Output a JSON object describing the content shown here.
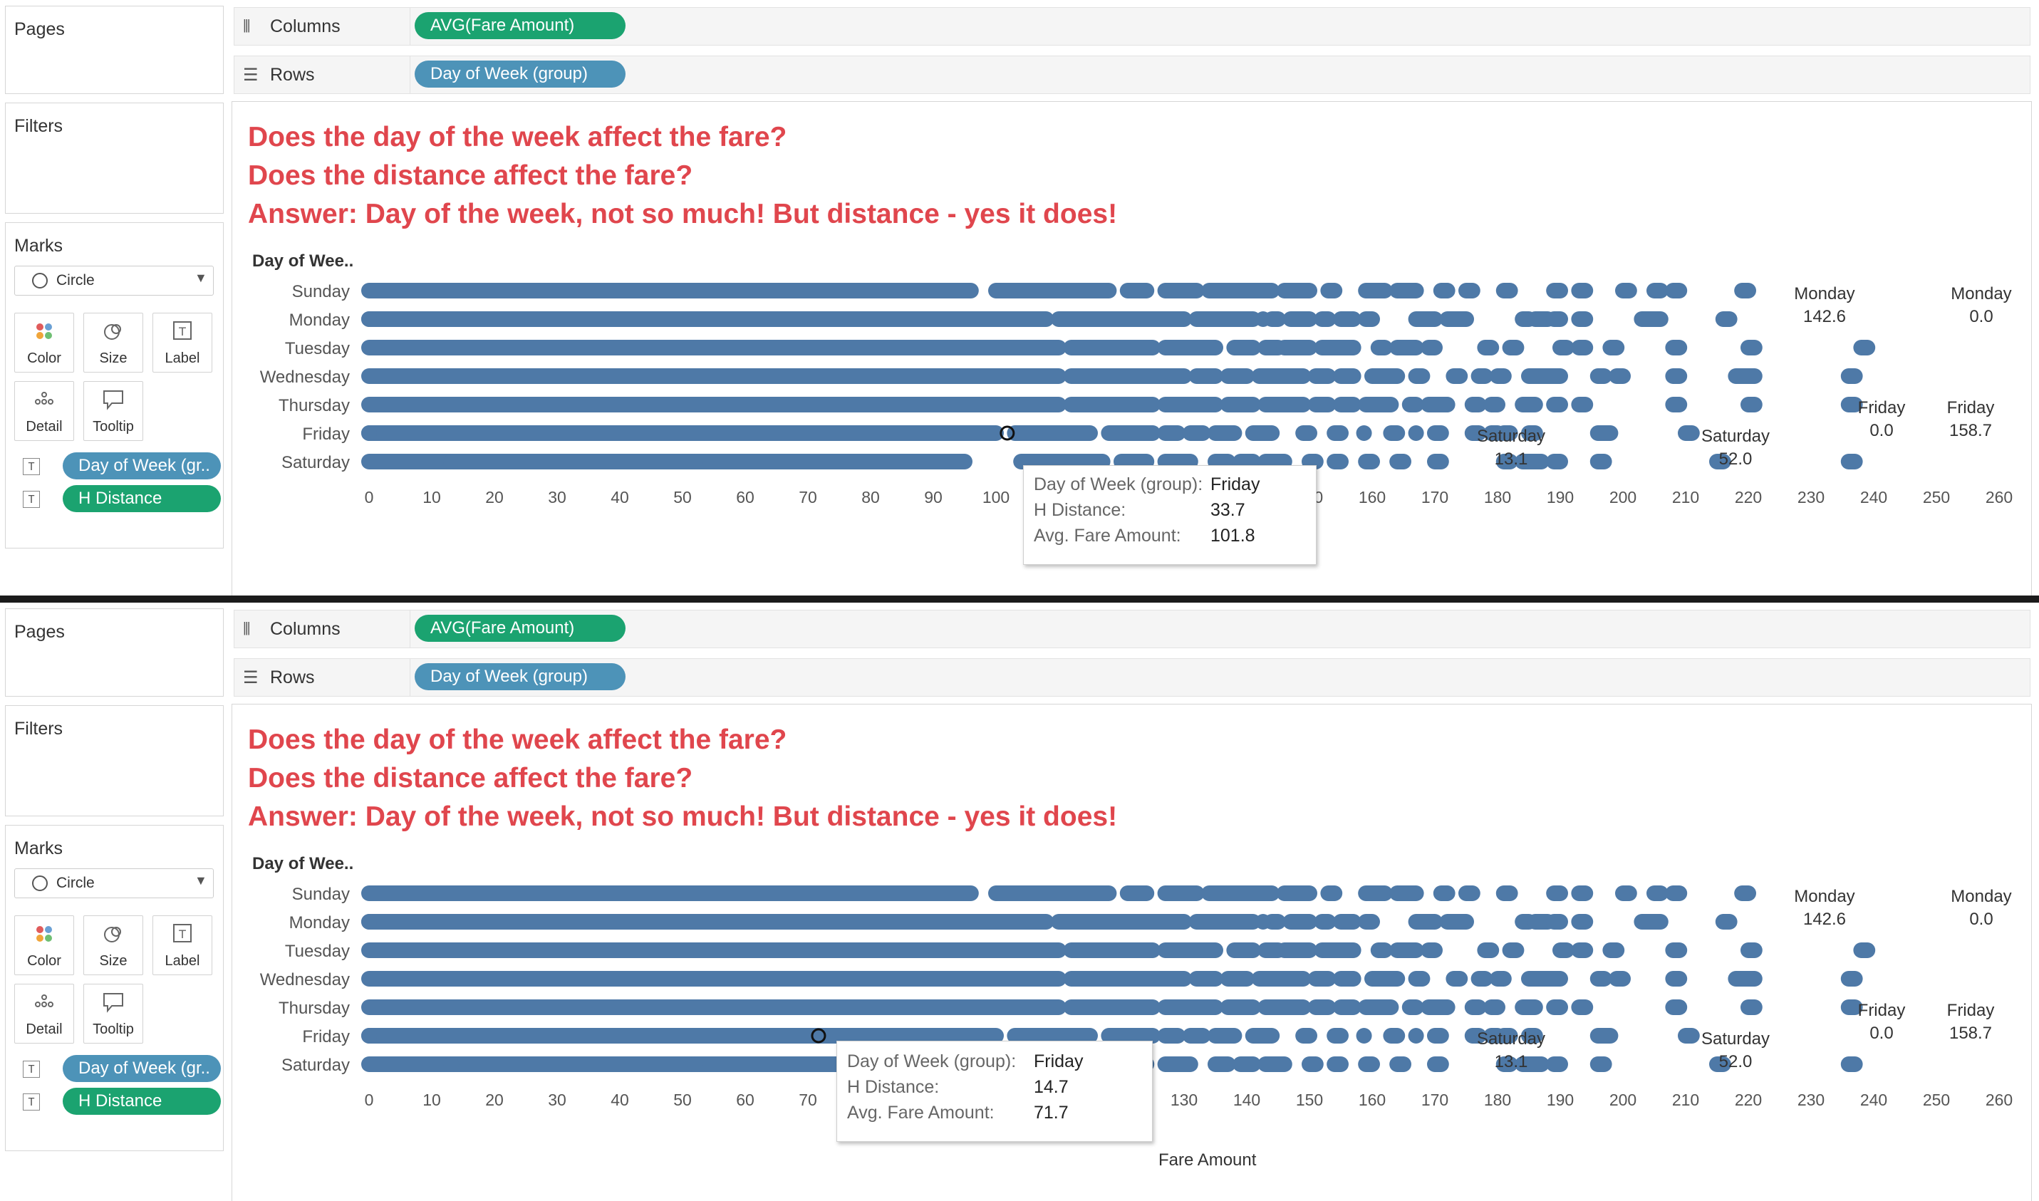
{
  "side": {
    "pages": "Pages",
    "filters": "Filters",
    "marks": "Marks"
  },
  "shelves": {
    "columns_label": "Columns",
    "rows_label": "Rows",
    "columns_pill": "AVG(Fare Amount)",
    "rows_pill": "Day of Week (group)"
  },
  "marks": {
    "type": "Circle",
    "buttons": {
      "color": "Color",
      "size": "Size",
      "label": "Label",
      "detail": "Detail",
      "tooltip": "Tooltip"
    },
    "fields": [
      "Day of Week (gr..",
      "H Distance"
    ]
  },
  "colors": {
    "title_red": "#e0464d",
    "mark_blue": "#4e79a7",
    "pill_green": "#1ba370",
    "pill_blue": "#4d93b8"
  },
  "icons": {
    "columns": "columns-icon",
    "rows": "rows-icon",
    "circle": "circle-icon",
    "dropdown": "chevron-down-icon",
    "color": "color-dots-icon",
    "size": "size-icon",
    "label": "label-icon",
    "detail": "detail-icon",
    "tooltip": "tooltip-icon",
    "field_type": "text-type-icon"
  },
  "viz": {
    "q1": "Does the day of the week affect the fare?",
    "q2": "Does the distance affect the fare?",
    "q3": "Answer: Day of the week, not so much! But distance - yes it does!",
    "row_header": "Day of Wee.."
  },
  "chart_data": {
    "type": "scatter",
    "y_categories": [
      "Sunday",
      "Monday",
      "Tuesday",
      "Wednesday",
      "Thursday",
      "Friday",
      "Saturday"
    ],
    "x_ticks": [
      0,
      10,
      20,
      30,
      40,
      50,
      60,
      70,
      80,
      90,
      100,
      110,
      120,
      130,
      140,
      150,
      160,
      170,
      180,
      190,
      200,
      210,
      220,
      230,
      240,
      250,
      260
    ],
    "xlim": [
      0,
      260
    ],
    "xlabel": "Fare Amount",
    "series_values": {
      "Sunday": [
        [
          0,
          96
        ],
        [
          100,
          118
        ],
        [
          121,
          124
        ],
        [
          127,
          132
        ],
        [
          134,
          144
        ],
        [
          146,
          150
        ],
        [
          153,
          154
        ],
        [
          159,
          162
        ],
        [
          164,
          167
        ],
        [
          171,
          172
        ],
        [
          175,
          176
        ],
        [
          181,
          182
        ],
        [
          189,
          190
        ],
        [
          193,
          194
        ],
        [
          200,
          201
        ],
        [
          205,
          206
        ],
        [
          208,
          209
        ],
        [
          219,
          220
        ]
      ],
      "Monday": [
        [
          0,
          108
        ],
        [
          110,
          130
        ],
        [
          132,
          141
        ],
        [
          144,
          145
        ],
        [
          147,
          150
        ],
        [
          152,
          153
        ],
        [
          155,
          157
        ],
        [
          159,
          160
        ],
        [
          167,
          170
        ],
        [
          172,
          175
        ],
        [
          184,
          185
        ],
        [
          186,
          188
        ],
        [
          189,
          190
        ],
        [
          193,
          194
        ],
        [
          203,
          206
        ],
        [
          216,
          217
        ]
      ],
      "Tuesday": [
        [
          0,
          110
        ],
        [
          112,
          125
        ],
        [
          127,
          135
        ],
        [
          138,
          141
        ],
        [
          143,
          145
        ],
        [
          146,
          150
        ],
        [
          152,
          157
        ],
        [
          161,
          162
        ],
        [
          164,
          167
        ],
        [
          169,
          170
        ],
        [
          178,
          179
        ],
        [
          182,
          183
        ],
        [
          190,
          191
        ],
        [
          193,
          194
        ],
        [
          198,
          199
        ],
        [
          208,
          209
        ],
        [
          220,
          221
        ],
        [
          238,
          239
        ]
      ],
      "Wednesday": [
        [
          0,
          110
        ],
        [
          112,
          130
        ],
        [
          132,
          135
        ],
        [
          137,
          140
        ],
        [
          142,
          149
        ],
        [
          151,
          153
        ],
        [
          155,
          157
        ],
        [
          160,
          164
        ],
        [
          167,
          168
        ],
        [
          173,
          174
        ],
        [
          177,
          178
        ],
        [
          180,
          181
        ],
        [
          185,
          190
        ],
        [
          196,
          197
        ],
        [
          199,
          200
        ],
        [
          208,
          209
        ],
        [
          218,
          221
        ],
        [
          236,
          237
        ]
      ],
      "Thursday": [
        [
          0,
          110
        ],
        [
          112,
          125
        ],
        [
          127,
          135
        ],
        [
          137,
          141
        ],
        [
          143,
          149
        ],
        [
          151,
          153
        ],
        [
          155,
          157
        ],
        [
          159,
          163
        ],
        [
          166,
          167
        ],
        [
          169,
          172
        ],
        [
          176,
          177
        ],
        [
          179,
          180
        ],
        [
          184,
          186
        ],
        [
          189,
          190
        ],
        [
          193,
          194
        ],
        [
          208,
          209
        ],
        [
          220,
          221
        ],
        [
          236,
          237
        ]
      ],
      "Friday": [
        [
          0,
          100
        ],
        [
          103,
          115
        ],
        [
          118,
          125
        ],
        [
          127,
          129
        ],
        [
          131,
          133
        ],
        [
          135,
          138
        ],
        [
          141,
          144
        ],
        [
          149,
          150
        ],
        [
          154,
          155
        ],
        [
          163,
          164
        ],
        [
          167,
          167
        ],
        [
          170,
          171
        ],
        [
          176,
          177
        ],
        [
          179,
          180
        ],
        [
          181,
          182
        ],
        [
          185,
          186
        ],
        [
          196,
          198
        ],
        [
          210,
          211
        ]
      ],
      "Saturday": [
        [
          0,
          95
        ],
        [
          104,
          117
        ],
        [
          120,
          124
        ],
        [
          127,
          131
        ],
        [
          135,
          137
        ],
        [
          139,
          141
        ],
        [
          143,
          146
        ],
        [
          150,
          151
        ],
        [
          154,
          155
        ],
        [
          159,
          160
        ],
        [
          164,
          165
        ],
        [
          170,
          171
        ],
        [
          181,
          182
        ],
        [
          184,
          187
        ],
        [
          189,
          190
        ],
        [
          196,
          197
        ],
        [
          215,
          216
        ],
        [
          236,
          237
        ]
      ]
    },
    "single_points": [
      {
        "day": "Monday",
        "x": 142.6
      },
      {
        "day": "Monday",
        "x": 0.0
      },
      {
        "day": "Friday",
        "x": 0.0
      },
      {
        "day": "Friday",
        "x": 158.7
      },
      {
        "day": "Saturday",
        "x": 13.1
      },
      {
        "day": "Saturday",
        "x": 52.0
      }
    ],
    "annotations": [
      {
        "day": "Monday",
        "value": "142.6",
        "label": "Monday"
      },
      {
        "day": "Monday",
        "value": "0.0",
        "label": "Monday"
      },
      {
        "day": "Friday",
        "value": "0.0",
        "label": "Friday"
      },
      {
        "day": "Friday",
        "value": "158.7",
        "label": "Friday"
      },
      {
        "day": "Saturday",
        "value": "13.1",
        "label": "Saturday"
      },
      {
        "day": "Saturday",
        "value": "52.0",
        "label": "Saturday"
      }
    ],
    "grid": false,
    "legend": "none"
  },
  "tooltips": [
    {
      "k1": "Day of Week (group):",
      "v1": "Friday",
      "k2": "H Distance:",
      "v2": "33.7",
      "k3": "Avg. Fare Amount:",
      "v3": "101.8",
      "hover_x": 101.8
    },
    {
      "k1": "Day of Week (group):",
      "v1": "Friday",
      "k2": "H Distance:",
      "v2": "14.7",
      "k3": "Avg. Fare Amount:",
      "v3": "71.7",
      "hover_x": 71.7
    }
  ]
}
